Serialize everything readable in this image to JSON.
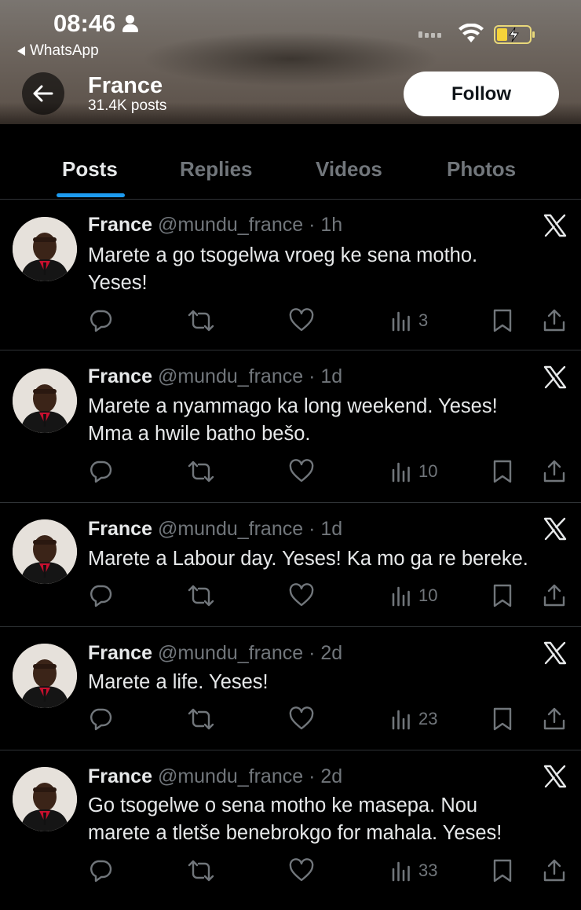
{
  "status_bar": {
    "time": "08:46",
    "back_app": "WhatsApp"
  },
  "profile": {
    "name": "France",
    "post_count": "31.4K posts",
    "follow_label": "Follow"
  },
  "tabs": [
    {
      "label": "Posts",
      "active": true
    },
    {
      "label": "Replies",
      "active": false
    },
    {
      "label": "Videos",
      "active": false
    },
    {
      "label": "Photos",
      "active": false
    }
  ],
  "posts": [
    {
      "name": "France",
      "meta": "@mundu_france · 1h",
      "lines": [
        "Marete a go tsogelwa vroeg ke sena motho.",
        "Yeses!"
      ],
      "views": "3"
    },
    {
      "name": "France",
      "meta": "@mundu_france · 1d",
      "lines": [
        "Marete a nyammago ka long weekend.  Yeses!",
        "Mma a hwile batho bešo."
      ],
      "views": "10"
    },
    {
      "name": "France",
      "meta": "@mundu_france · 1d",
      "lines": [
        "Marete a Labour day. Yeses! Ka mo ga re bereke."
      ],
      "views": "10"
    },
    {
      "name": "France",
      "meta": "@mundu_france · 2d",
      "lines": [
        "Marete a life. Yeses!"
      ],
      "views": "23"
    },
    {
      "name": "France",
      "meta": "@mundu_france · 2d",
      "lines": [
        "Go tsogelwe o sena motho ke masepa. Nou",
        "marete a tletše benebrokgo for mahala. Yeses!"
      ],
      "views": "33"
    }
  ],
  "icons": {
    "back": "arrow-left-icon",
    "reply": "reply-icon",
    "repost": "repost-icon",
    "like": "heart-icon",
    "views": "views-icon",
    "bookmark": "bookmark-icon",
    "share": "share-icon",
    "x": "x-logo-icon"
  },
  "colors": {
    "accent": "#1d9bf0",
    "background": "#000000",
    "muted": "#71767b",
    "text": "#e7e9ea"
  }
}
